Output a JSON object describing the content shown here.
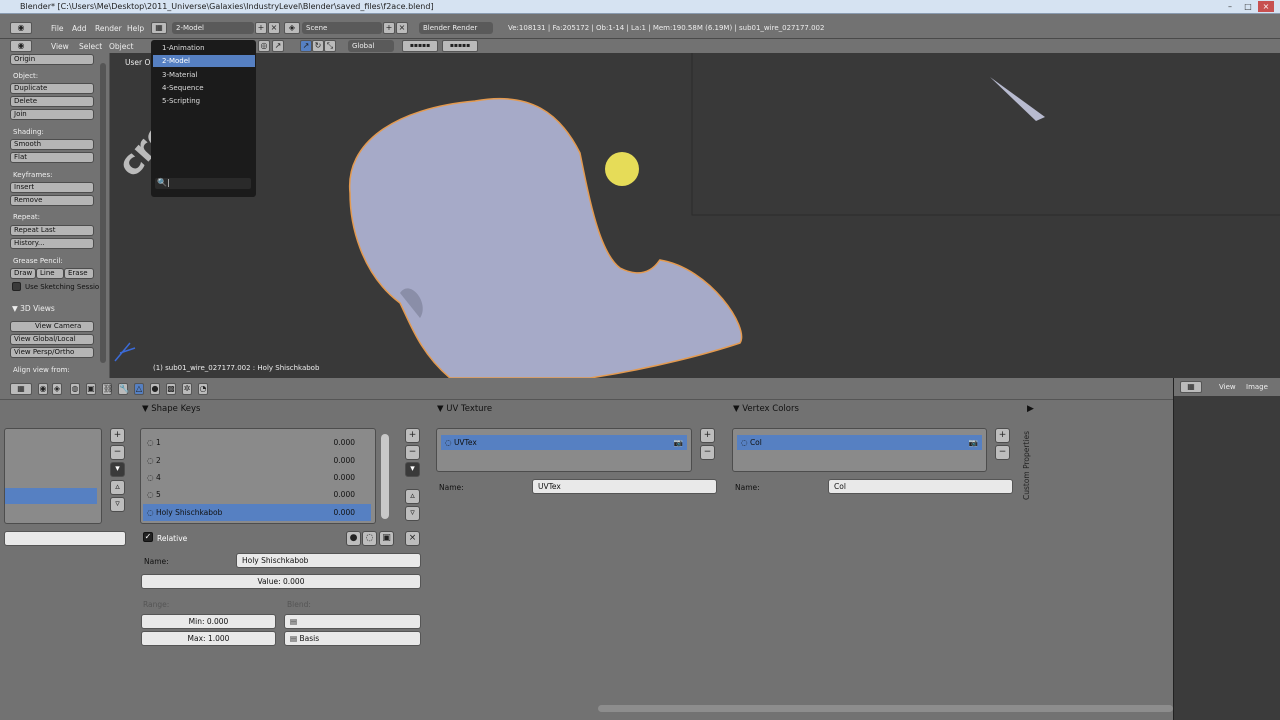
{
  "titlebar": {
    "title": "Blender* [C:\\Users\\Me\\Desktop\\2011_Universe\\Galaxies\\IndustryLevel\\Blender\\saved_files\\f2ace.blend]"
  },
  "info_header": {
    "menus": [
      "File",
      "Add",
      "Render",
      "Help"
    ],
    "screen_layout": "2-Model",
    "scene": "Scene",
    "render_engine": "Blender Render",
    "stats": "Ve:108131 | Fa:205172 | Ob:1-14 | La:1 | Mem:190.58M (6.19M) | sub01_wire_027177.002"
  },
  "view_header": {
    "menus": [
      "View",
      "Select",
      "Object"
    ],
    "orientation": "Global"
  },
  "layout_menu": {
    "items": [
      "1-Animation",
      "2-Model",
      "3-Material",
      "4-Sequence",
      "5-Scripting"
    ],
    "selected": "2-Model"
  },
  "toolshelf": {
    "origin": "Origin",
    "object_label": "Object:",
    "duplicate": "Duplicate",
    "delete": "Delete",
    "join": "Join",
    "shading_label": "Shading:",
    "smooth": "Smooth",
    "flat": "Flat",
    "keyframes_label": "Keyframes:",
    "insert": "Insert",
    "remove": "Remove",
    "repeat_label": "Repeat:",
    "repeat_last": "Repeat Last",
    "history": "History...",
    "grease_label": "Grease Pencil:",
    "draw": "Draw",
    "line": "Line",
    "erase": "Erase",
    "use_sketching": "Use Sketching Sessio",
    "views_header": "3D Views",
    "view_camera": "View Camera",
    "view_global": "View Global/Local",
    "view_persp": "View Persp/Ortho",
    "align_view": "Align view from:"
  },
  "viewport": {
    "view_label": "User Or",
    "object_info": "(1) sub01_wire_027177.002 : Holy Shischkabob",
    "watermark": "cro.net"
  },
  "shape_keys": {
    "header": "Shape Keys",
    "keys": [
      {
        "name": "1",
        "value": "0.000"
      },
      {
        "name": "2",
        "value": "0.000"
      },
      {
        "name": "4",
        "value": "0.000"
      },
      {
        "name": "5",
        "value": "0.000"
      },
      {
        "name": "Holy Shischkabob",
        "value": "0.000"
      }
    ],
    "relative_label": "Relative",
    "name_label": "Name:",
    "name_value": "Holy Shischkabob",
    "value_field": "Value: 0.000",
    "range_label": "Range:",
    "min_field": "Min: 0.000",
    "max_field": "Max: 1.000",
    "blend_label": "Blend:",
    "basis": "Basis"
  },
  "uv_texture": {
    "header": "UV Texture",
    "item": "UVTex",
    "name_label": "Name:",
    "name_value": "UVTex"
  },
  "vertex_colors": {
    "header": "Vertex Colors",
    "item": "Col",
    "name_label": "Name:",
    "name_value": "Col"
  },
  "custom_props": {
    "label": "Custom Properties"
  },
  "right_header": {
    "view": "View",
    "image": "Image"
  }
}
